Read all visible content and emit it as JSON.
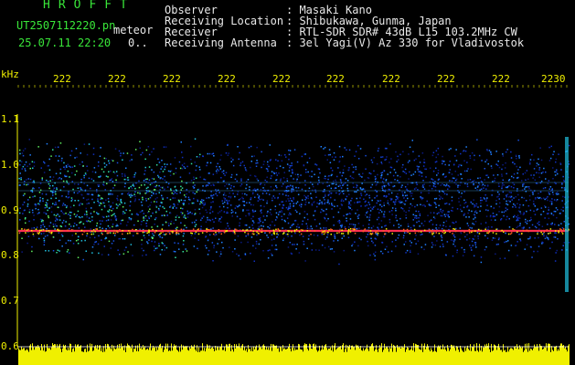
{
  "header": {
    "app_title": "HROFFT",
    "file_name": "UT2507112220.pn",
    "meteor_label": "meteor",
    "date_time": "25.07.11 22:20",
    "count": "0..",
    "observer_label": "Observer",
    "observer_value": ": Masaki Kano",
    "location_label": "Receiving Location",
    "location_value": ": Shibukawa, Gunma, Japan",
    "receiver_label": "Receiver",
    "receiver_value": ": RTL-SDR SDR# 43dB L15 103.2MHz CW",
    "antenna_label": "Receiving Antenna",
    "antenna_value": ": 3el Yagi(V) Az 330 for Vladivostok"
  },
  "axes": {
    "unit": "kHz",
    "time_ticks": [
      "222",
      "222",
      "222",
      "222",
      "222",
      "222",
      "222",
      "222",
      "222",
      "2230"
    ],
    "freq_ticks": [
      "1.1",
      "1.0",
      "0.9",
      "0.8",
      "0.7",
      "0.6"
    ]
  },
  "colors": {
    "background": "#000000",
    "label_yellow": "#f0f000",
    "title_green": "#39e639",
    "text_white": "#e8e8e8",
    "carrier": "#ff3050",
    "noise_blue": "#1030c0"
  }
}
